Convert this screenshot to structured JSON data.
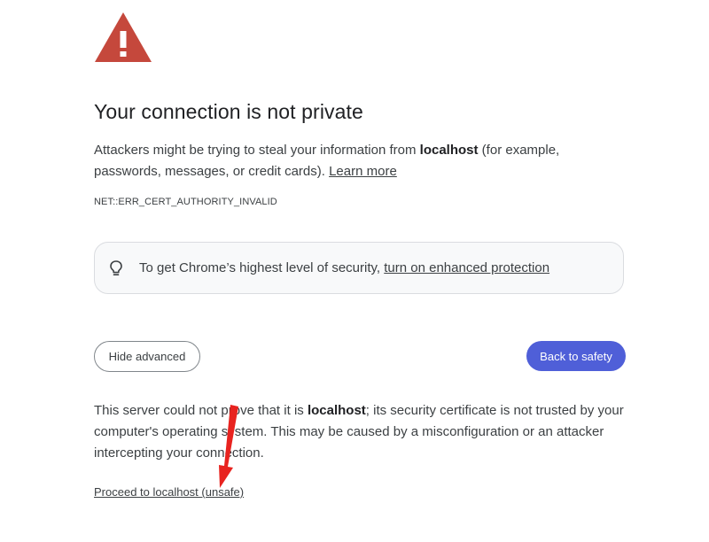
{
  "icons": {
    "warning": "warning-triangle-icon",
    "tip": "lightbulb-icon"
  },
  "colors": {
    "warning_red": "#c5483c",
    "primary_button": "#4f5fd8",
    "annotation_arrow": "#e8231f"
  },
  "title": "Your connection is not private",
  "intro": {
    "before_host": "Attackers might be trying to steal your information from ",
    "host": "localhost",
    "after_host": " (for example, passwords, messages, or credit cards). ",
    "learn_more": "Learn more"
  },
  "error_code": "NET::ERR_CERT_AUTHORITY_INVALID",
  "tip": {
    "text": "To get Chrome’s highest level of security, ",
    "link": "turn on enhanced protection"
  },
  "buttons": {
    "hide_advanced": "Hide advanced",
    "back_to_safety": "Back to safety"
  },
  "details": {
    "before_host": "This server could not prove that it is ",
    "host": "localhost",
    "after_host": "; its security certificate is not trusted by your computer's operating system. This may be caused by a misconfiguration or an attacker intercepting your connection."
  },
  "proceed_link": "Proceed to localhost (unsafe)"
}
